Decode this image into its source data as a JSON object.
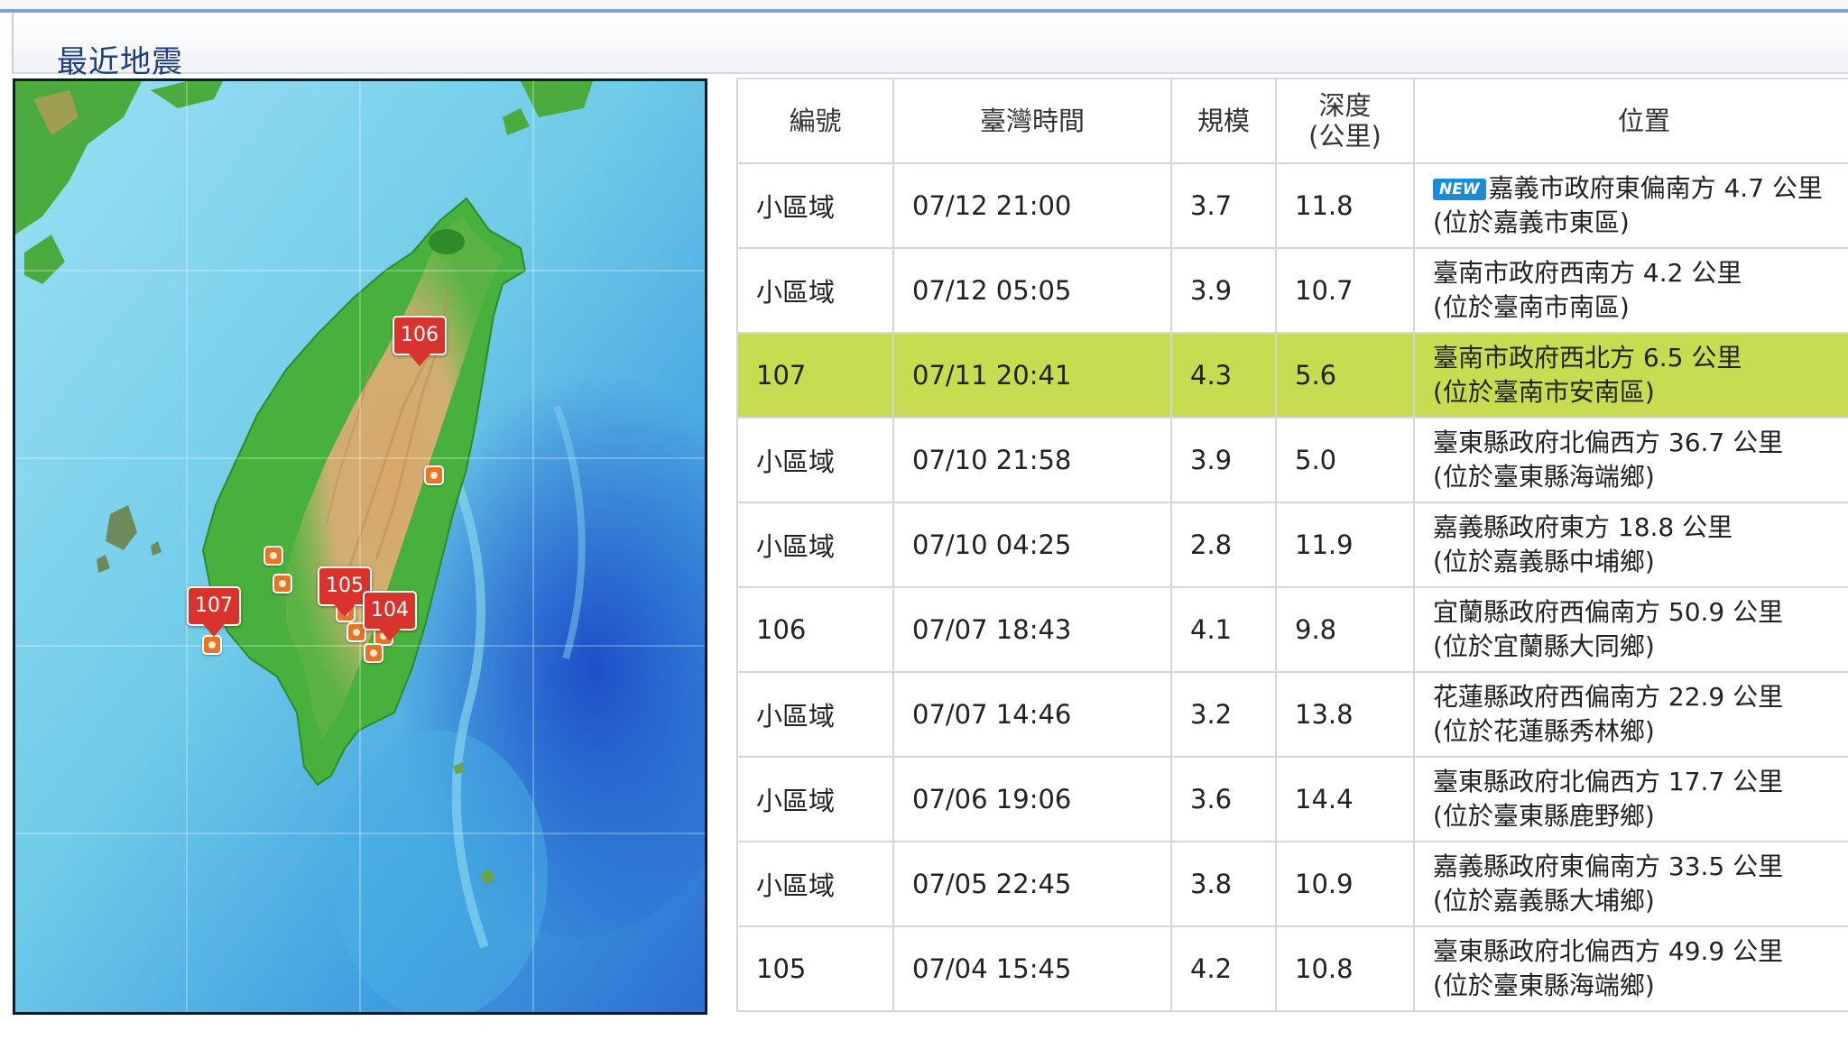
{
  "panel": {
    "title": "最近地震"
  },
  "table": {
    "headers": {
      "id": "編號",
      "time": "臺灣時間",
      "magnitude": "規模",
      "depth_line1": "深度",
      "depth_line2": "(公里)",
      "location": "位置"
    },
    "new_badge": "NEW",
    "rows": [
      {
        "id": "小區域",
        "time": "07/12 21:00",
        "magnitude": "3.7",
        "depth": "11.8",
        "location": "嘉義市政府東偏南方 4.7 公里",
        "sublocation": "(位於嘉義市東區)"
      },
      {
        "id": "小區域",
        "time": "07/12 05:05",
        "magnitude": "3.9",
        "depth": "10.7",
        "location": "臺南市政府西南方 4.2 公里",
        "sublocation": "(位於臺南市南區)"
      },
      {
        "id": "107",
        "time": "07/11 20:41",
        "magnitude": "4.3",
        "depth": "5.6",
        "location": "臺南市政府西北方 6.5 公里",
        "sublocation": "(位於臺南市安南區)"
      },
      {
        "id": "小區域",
        "time": "07/10 21:58",
        "magnitude": "3.9",
        "depth": "5.0",
        "location": "臺東縣政府北偏西方 36.7 公里",
        "sublocation": "(位於臺東縣海端鄉)"
      },
      {
        "id": "小區域",
        "time": "07/10 04:25",
        "magnitude": "2.8",
        "depth": "11.9",
        "location": "嘉義縣政府東方 18.8 公里",
        "sublocation": "(位於嘉義縣中埔鄉)"
      },
      {
        "id": "106",
        "time": "07/07 18:43",
        "magnitude": "4.1",
        "depth": "9.8",
        "location": "宜蘭縣政府西偏南方 50.9 公里",
        "sublocation": "(位於宜蘭縣大同鄉)"
      },
      {
        "id": "小區域",
        "time": "07/07 14:46",
        "magnitude": "3.2",
        "depth": "13.8",
        "location": "花蓮縣政府西偏南方 22.9 公里",
        "sublocation": "(位於花蓮縣秀林鄉)"
      },
      {
        "id": "小區域",
        "time": "07/06 19:06",
        "magnitude": "3.6",
        "depth": "14.4",
        "location": "臺東縣政府北偏西方 17.7 公里",
        "sublocation": "(位於臺東縣鹿野鄉)"
      },
      {
        "id": "小區域",
        "time": "07/05 22:45",
        "magnitude": "3.8",
        "depth": "10.9",
        "location": "嘉義縣政府東偏南方 33.5 公里",
        "sublocation": "(位於嘉義縣大埔鄉)"
      },
      {
        "id": "105",
        "time": "07/04 15:45",
        "magnitude": "4.2",
        "depth": "10.8",
        "location": "臺東縣政府北偏西方 49.9 公里",
        "sublocation": "(位於臺東縣海端鄉)"
      }
    ]
  },
  "map": {
    "pins": [
      "106",
      "105",
      "104",
      "107"
    ]
  },
  "colors": {
    "selected_row": "#c8dc52",
    "numbered_pin": "#d9332e",
    "small_marker": "#e8742a",
    "new_badge": "#1d8ad6",
    "title_text": "#1f3f7a"
  }
}
